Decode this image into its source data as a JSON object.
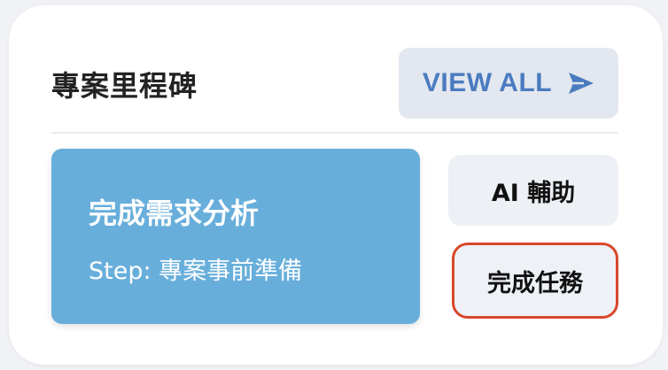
{
  "header": {
    "title": "專案里程碑",
    "view_all_label": "VIEW ALL",
    "view_all_icon": "send-icon"
  },
  "milestone": {
    "title": "完成需求分析",
    "step": "Step: 專案事前準備"
  },
  "actions": {
    "ai_assist_label": "AI 輔助",
    "complete_task_label": "完成任務"
  },
  "colors": {
    "accent": "#4a7bc0",
    "milestone_bg": "#67aedb",
    "highlight_border": "#d9472b"
  }
}
